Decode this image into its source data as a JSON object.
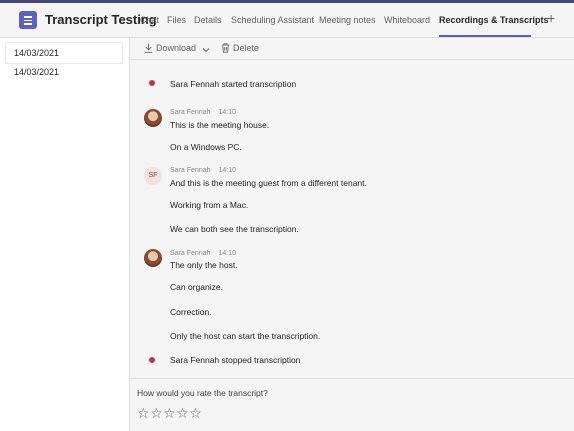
{
  "header": {
    "title": "Transcript Testing",
    "tabs": [
      {
        "label": "Chat"
      },
      {
        "label": "Files"
      },
      {
        "label": "Details"
      },
      {
        "label": "Scheduling Assistant"
      },
      {
        "label": "Meeting notes"
      },
      {
        "label": "Whiteboard"
      },
      {
        "label": "Recordings & Transcripts"
      }
    ],
    "active_tab": "Recordings & Transcripts",
    "add_tab_symbol": "+"
  },
  "sidebar": {
    "items": [
      {
        "label": "14/03/2021",
        "selected": true
      },
      {
        "label": "14/03/2021",
        "selected": false
      }
    ]
  },
  "toolbar": {
    "download_label": "Download",
    "delete_label": "Delete"
  },
  "transcript": {
    "start_event": "Sara Fennah started transcription",
    "entries": [
      {
        "speaker": "Sara Fennah",
        "time": "14:10",
        "avatar": "photo",
        "lines": [
          "This is the meeting house.",
          "On a Windows PC."
        ]
      },
      {
        "speaker": "Sara Fennah",
        "time": "14:10",
        "avatar": "initials",
        "initials": "SF",
        "lines": [
          "And this is the meeting guest from a different tenant.",
          "Working from a Mac.",
          "We can both see the transcription."
        ]
      },
      {
        "speaker": "Sara Fennah",
        "time": "14:10",
        "avatar": "photo",
        "lines": [
          "The only the host.",
          "Can organize.",
          "Correction.",
          "Only the host can start the transcription."
        ]
      }
    ],
    "stop_event": "Sara Fennah stopped transcription"
  },
  "rating": {
    "question": "How would you rate the transcript?",
    "max_stars": 5,
    "selected_stars": 0,
    "star_glyph": "☆"
  },
  "colors": {
    "accent": "#5b5fc7",
    "top_bar": "#464775",
    "event_dot": "#c4314b"
  }
}
